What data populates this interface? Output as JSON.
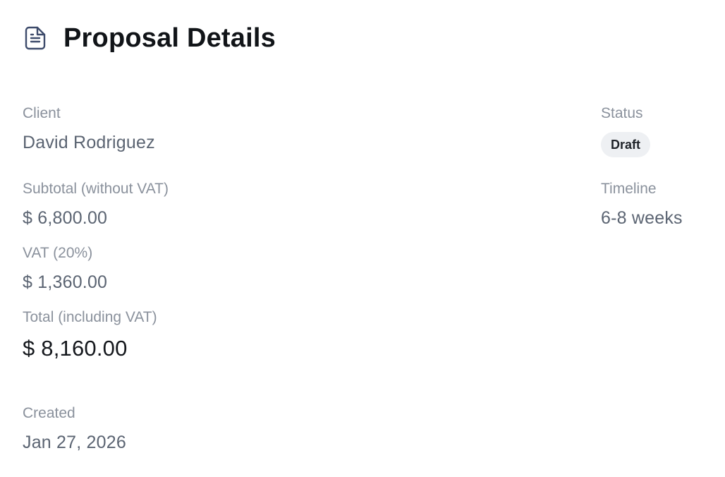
{
  "header": {
    "icon": "document-icon",
    "title": "Proposal Details"
  },
  "fields": {
    "client": {
      "label": "Client",
      "value": "David Rodriguez"
    },
    "status": {
      "label": "Status",
      "value": "Draft"
    },
    "subtotal": {
      "label": "Subtotal (without VAT)",
      "value": "$ 6,800.00"
    },
    "timeline": {
      "label": "Timeline",
      "value": "6-8 weeks"
    },
    "vat": {
      "label": "VAT (20%)",
      "value": "$ 1,360.00"
    },
    "total": {
      "label": "Total (including VAT)",
      "value": "$ 8,160.00"
    },
    "created": {
      "label": "Created",
      "value": "Jan 27, 2026"
    }
  },
  "colors": {
    "title": "#111418",
    "label": "#8a919c",
    "value": "#5b6472",
    "icon": "#3d4b6b",
    "badge_bg": "#eef0f3"
  }
}
